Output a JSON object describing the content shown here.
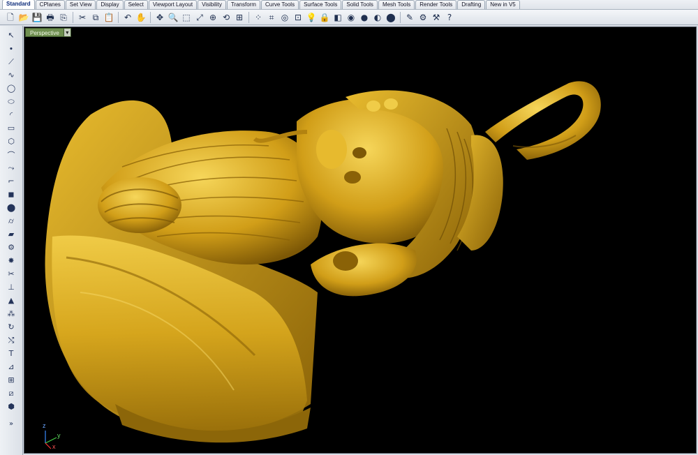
{
  "tabs": [
    "Standard",
    "CPlanes",
    "Set View",
    "Display",
    "Select",
    "Viewport Layout",
    "Visibility",
    "Transform",
    "Curve Tools",
    "Surface Tools",
    "Solid Tools",
    "Mesh Tools",
    "Render Tools",
    "Drafting",
    "New in V5"
  ],
  "active_tab": "Standard",
  "viewport": {
    "title": "Perspective",
    "caret": "▼"
  },
  "axes": {
    "x": "x",
    "y": "y",
    "z": "z"
  },
  "colors": {
    "background": "#000000",
    "model_gold": "#d8a820",
    "viewport_label": "#6f8f50"
  },
  "toolbar_icons": [
    {
      "name": "new-file-icon",
      "glyph": "🗋"
    },
    {
      "name": "open-file-icon",
      "glyph": "📂"
    },
    {
      "name": "save-icon",
      "glyph": "💾"
    },
    {
      "name": "print-icon",
      "glyph": "🖶"
    },
    {
      "name": "import-icon",
      "glyph": "⎘"
    },
    {
      "name": "sep"
    },
    {
      "name": "cut-icon",
      "glyph": "✂"
    },
    {
      "name": "copy-icon",
      "glyph": "⧉"
    },
    {
      "name": "paste-icon",
      "glyph": "📋"
    },
    {
      "name": "sep"
    },
    {
      "name": "undo-icon",
      "glyph": "↶"
    },
    {
      "name": "pan-hand-icon",
      "glyph": "✋"
    },
    {
      "name": "sep"
    },
    {
      "name": "move-view-icon",
      "glyph": "✥"
    },
    {
      "name": "zoom-icon",
      "glyph": "🔍"
    },
    {
      "name": "zoom-window-icon",
      "glyph": "⬚"
    },
    {
      "name": "zoom-extents-icon",
      "glyph": "⤢"
    },
    {
      "name": "zoom-selected-icon",
      "glyph": "⊕"
    },
    {
      "name": "rotate-view-icon",
      "glyph": "⟲"
    },
    {
      "name": "four-viewports-icon",
      "glyph": "⊞"
    },
    {
      "name": "sep"
    },
    {
      "name": "select-points-icon",
      "glyph": "⁘"
    },
    {
      "name": "grid-snap-icon",
      "glyph": "⌗"
    },
    {
      "name": "osnap-icon",
      "glyph": "◎"
    },
    {
      "name": "cplane-icon",
      "glyph": "⊡"
    },
    {
      "name": "light-bulb-icon",
      "glyph": "💡"
    },
    {
      "name": "lock-icon",
      "glyph": "🔒"
    },
    {
      "name": "layer-icon",
      "glyph": "◧"
    },
    {
      "name": "color-wheel-icon",
      "glyph": "◉"
    },
    {
      "name": "shaded-sphere-icon",
      "glyph": "●"
    },
    {
      "name": "rendered-sphere-icon",
      "glyph": "◐"
    },
    {
      "name": "render-sphere-icon",
      "glyph": "⬤"
    },
    {
      "name": "sep"
    },
    {
      "name": "properties-icon",
      "glyph": "✎"
    },
    {
      "name": "options-gear-icon",
      "glyph": "⚙"
    },
    {
      "name": "tools-icon",
      "glyph": "⚒"
    },
    {
      "name": "help-icon",
      "glyph": "?"
    }
  ],
  "left_icons": [
    {
      "name": "select-arrow-icon",
      "glyph": "↖"
    },
    {
      "name": "point-icon",
      "glyph": "∙"
    },
    {
      "name": "polyline-icon",
      "glyph": "⟋"
    },
    {
      "name": "curve-icon",
      "glyph": "∿"
    },
    {
      "name": "circle-icon",
      "glyph": "◯"
    },
    {
      "name": "ellipse-icon",
      "glyph": "⬭"
    },
    {
      "name": "arc-icon",
      "glyph": "◜"
    },
    {
      "name": "rectangle-icon",
      "glyph": "▭"
    },
    {
      "name": "polygon-icon",
      "glyph": "⬡"
    },
    {
      "name": "freeform-curve-icon",
      "glyph": "⌒"
    },
    {
      "name": "curve-edit-icon",
      "glyph": "⤳"
    },
    {
      "name": "fillet-icon",
      "glyph": "⌐"
    },
    {
      "name": "box-icon",
      "glyph": "◼"
    },
    {
      "name": "sphere-icon",
      "glyph": "⬤"
    },
    {
      "name": "cylinder-icon",
      "glyph": "⌭"
    },
    {
      "name": "surface-icon",
      "glyph": "▰"
    },
    {
      "name": "boolean-icon",
      "glyph": "⚙"
    },
    {
      "name": "explode-icon",
      "glyph": "✸"
    },
    {
      "name": "trim-icon",
      "glyph": "✂"
    },
    {
      "name": "split-icon",
      "glyph": "⊥"
    },
    {
      "name": "mesh-icon",
      "glyph": "▲"
    },
    {
      "name": "array-icon",
      "glyph": "⁂"
    },
    {
      "name": "rotate-icon",
      "glyph": "↻"
    },
    {
      "name": "move-icon",
      "glyph": "⤭"
    },
    {
      "name": "text-icon",
      "glyph": "T"
    },
    {
      "name": "dimension-icon",
      "glyph": "⊿"
    },
    {
      "name": "group-icon",
      "glyph": "⊞"
    },
    {
      "name": "transform-icon",
      "glyph": "⧄"
    },
    {
      "name": "block-icon",
      "glyph": "⬢"
    },
    {
      "name": "expand-more-icon",
      "glyph": "»"
    }
  ]
}
